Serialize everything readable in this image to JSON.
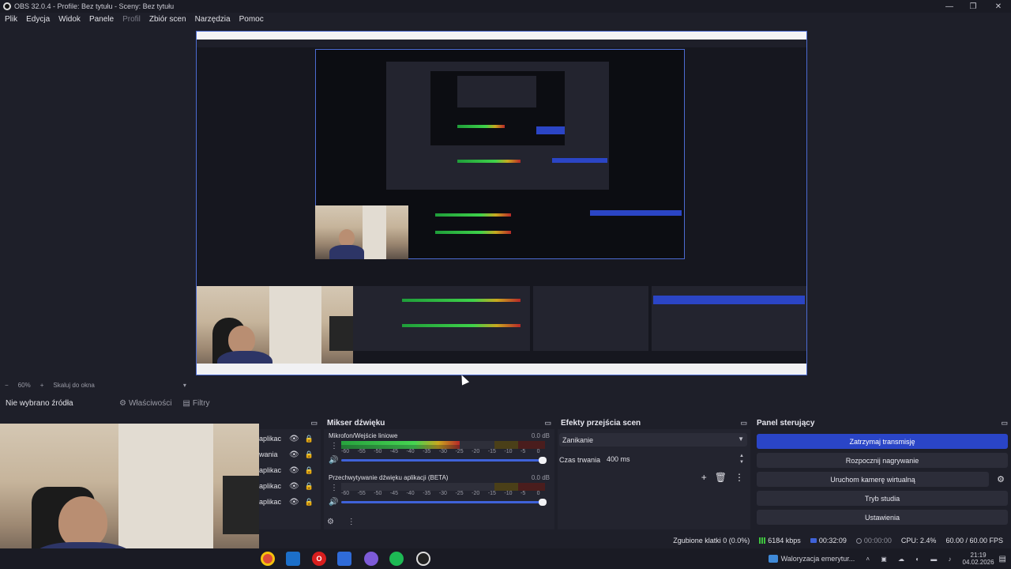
{
  "window": {
    "title": "OBS 32.0.4 - Profile: Bez tytułu - Sceny: Bez tytułu",
    "minimize": "—",
    "maximize": "❐",
    "close": "✕"
  },
  "menu": [
    "Plik",
    "Edycja",
    "Widok",
    "Panele",
    "Profil",
    "Zbiór scen",
    "Narzędzia",
    "Pomoc"
  ],
  "zoombar": {
    "minus": "−",
    "zoom": "60%",
    "plus": "+",
    "fit": "Skaluj do okna",
    "dropdown": "▾"
  },
  "sourcebar": {
    "no_source": "Nie wybrano źródła",
    "properties": "Właściwości",
    "filters": "Filtry"
  },
  "sources": {
    "rows": [
      "aplikac",
      "wania",
      "aplikac",
      "aplikac",
      "aplikac"
    ]
  },
  "mixer": {
    "title": "Mikser dźwięku",
    "channels": [
      {
        "name": "Mikrofon/Wejście liniowe",
        "db": "0.0 dB",
        "level": 0.58
      },
      {
        "name": "Przechwytywanie dźwięku aplikacji (BETA)",
        "db": "0.0 dB",
        "level": 0.0
      }
    ],
    "scale": [
      "-60",
      "-55",
      "-50",
      "-45",
      "-40",
      "-35",
      "-30",
      "-25",
      "-20",
      "-15",
      "-10",
      "-5",
      "0"
    ]
  },
  "transitions": {
    "title": "Efekty przejścia scen",
    "selected": "Zanikanie",
    "duration_label": "Czas trwania",
    "duration_value": "400 ms"
  },
  "controls": {
    "title": "Panel sterujący",
    "stop_stream": "Zatrzymaj transmisję",
    "start_record": "Rozpocznij nagrywanie",
    "virtual_cam": "Uruchom kamerę wirtualną",
    "studio_mode": "Tryb studia",
    "settings": "Ustawienia"
  },
  "status": {
    "dropped": "Zgubione klatki 0 (0.0%)",
    "bitrate": "6184 kbps",
    "stream_time": "00:32:09",
    "rec_time": "00:00:00",
    "cpu": "CPU: 2.4%",
    "fps": "60.00 / 60.00 FPS"
  },
  "taskbar": {
    "notification": "Waloryzacja emerytur...",
    "time": "21:19",
    "date": "04.02.2026"
  },
  "colors": {
    "accent": "#2a45c7",
    "background": "#1e1f29",
    "panel": "#23242f"
  }
}
